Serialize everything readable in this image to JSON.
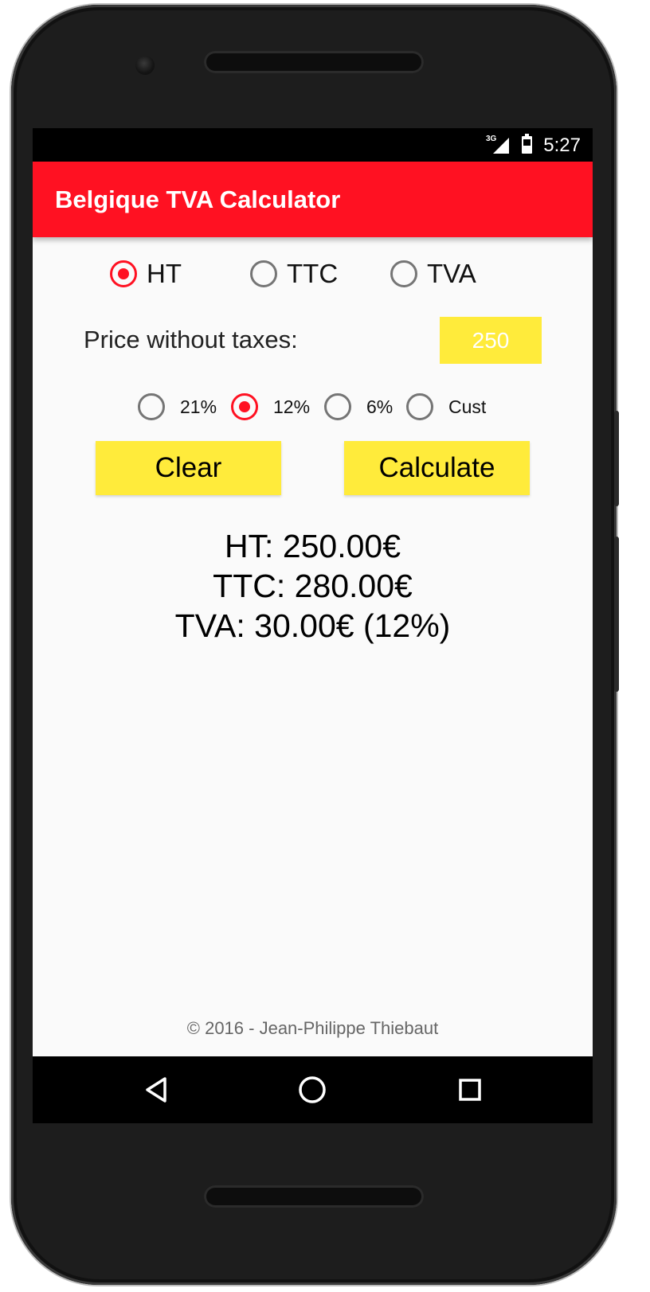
{
  "status_bar": {
    "network": "3G",
    "time": "5:27"
  },
  "app_bar": {
    "title": "Belgique TVA Calculator"
  },
  "mode_options": [
    {
      "label": "HT",
      "checked": true
    },
    {
      "label": "TTC",
      "checked": false
    },
    {
      "label": "TVA",
      "checked": false
    }
  ],
  "price": {
    "label": "Price without taxes:",
    "value": "250"
  },
  "rate_options": [
    {
      "label": "21%",
      "checked": false
    },
    {
      "label": "12%",
      "checked": true
    },
    {
      "label": "6%",
      "checked": false
    },
    {
      "label": "Cust",
      "checked": false
    }
  ],
  "buttons": {
    "clear": "Clear",
    "calculate": "Calculate"
  },
  "results": {
    "ht": "HT: 250.00€",
    "ttc": "TTC: 280.00€",
    "tva": "TVA: 30.00€ (12%)"
  },
  "footer": "© 2016 - Jean-Philippe Thiebaut",
  "colors": {
    "accent": "#ff1122",
    "button": "#ffeb3b"
  },
  "icons": {
    "nav": [
      "back-icon",
      "home-icon",
      "recents-icon"
    ]
  }
}
